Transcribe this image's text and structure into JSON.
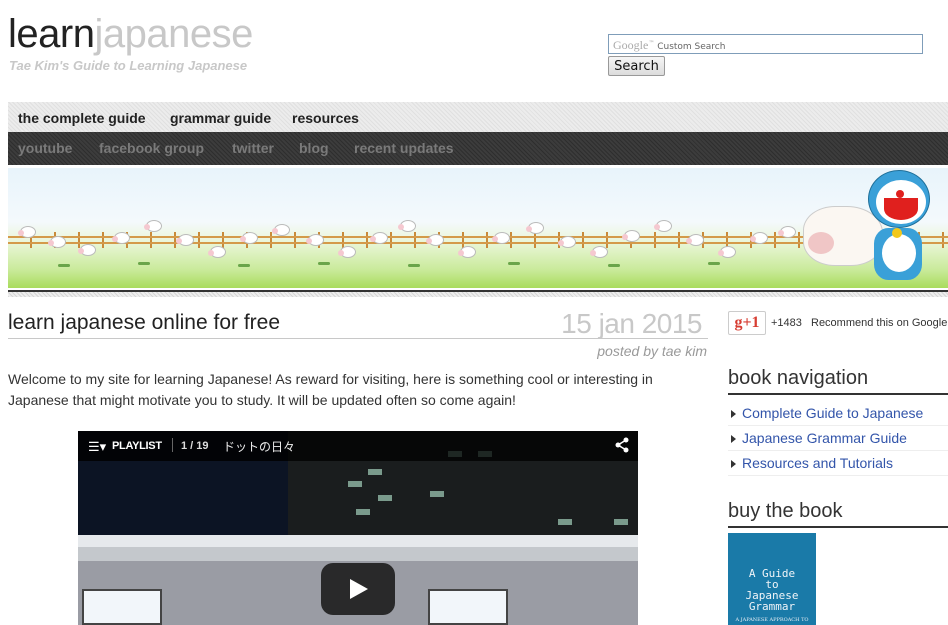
{
  "header": {
    "logo_part1": "learn",
    "logo_part2": "japanese",
    "tagline": "Tae Kim's Guide to Learning Japanese",
    "search": {
      "placeholder_brand": "Google",
      "placeholder_tm": "™",
      "placeholder_text": "Custom Search",
      "button_label": "Search"
    }
  },
  "nav_primary": [
    {
      "label": "the complete guide"
    },
    {
      "label": "grammar guide"
    },
    {
      "label": "resources"
    }
  ],
  "nav_secondary": [
    {
      "label": "youtube"
    },
    {
      "label": "facebook group"
    },
    {
      "label": "twitter"
    },
    {
      "label": "blog"
    },
    {
      "label": "recent updates"
    }
  ],
  "post": {
    "title": "learn japanese online for free",
    "date": "15 jan 2015",
    "byline": "posted by tae kim",
    "body": "Welcome to my site for learning Japanese! As reward for visiting, here is something cool or interesting in Japanese that might motivate you to study. It will be updated often so come again!"
  },
  "video": {
    "menu_icon": "☰▾",
    "playlist_label": "PLAYLIST",
    "position": "1 / 19",
    "title": "ドットの日々",
    "share_icon": "share-icon",
    "play_icon": "play-icon"
  },
  "sidebar": {
    "gplus": {
      "button_label": "g+1",
      "count": "+1483",
      "label": "Recommend this on Google"
    },
    "book_nav": {
      "heading": "book navigation",
      "items": [
        {
          "label": "Complete Guide to Japanese"
        },
        {
          "label": "Japanese Grammar Guide"
        },
        {
          "label": "Resources and Tutorials"
        }
      ]
    },
    "buy": {
      "heading": "buy the book",
      "cover_title": "A Guide to Japanese Grammar",
      "cover_line1": "A Guide",
      "cover_line2": "to",
      "cover_line3": "Japanese",
      "cover_line4": "Grammar",
      "cover_subtitle": "A JAPANESE APPROACH TO"
    }
  },
  "colors": {
    "link": "#3355aa",
    "logo_dark": "#222222",
    "logo_light": "#c8c8c8",
    "nav_dark": "#333333",
    "book_cover": "#1a7aa8",
    "gplus_red": "#d73d32"
  }
}
